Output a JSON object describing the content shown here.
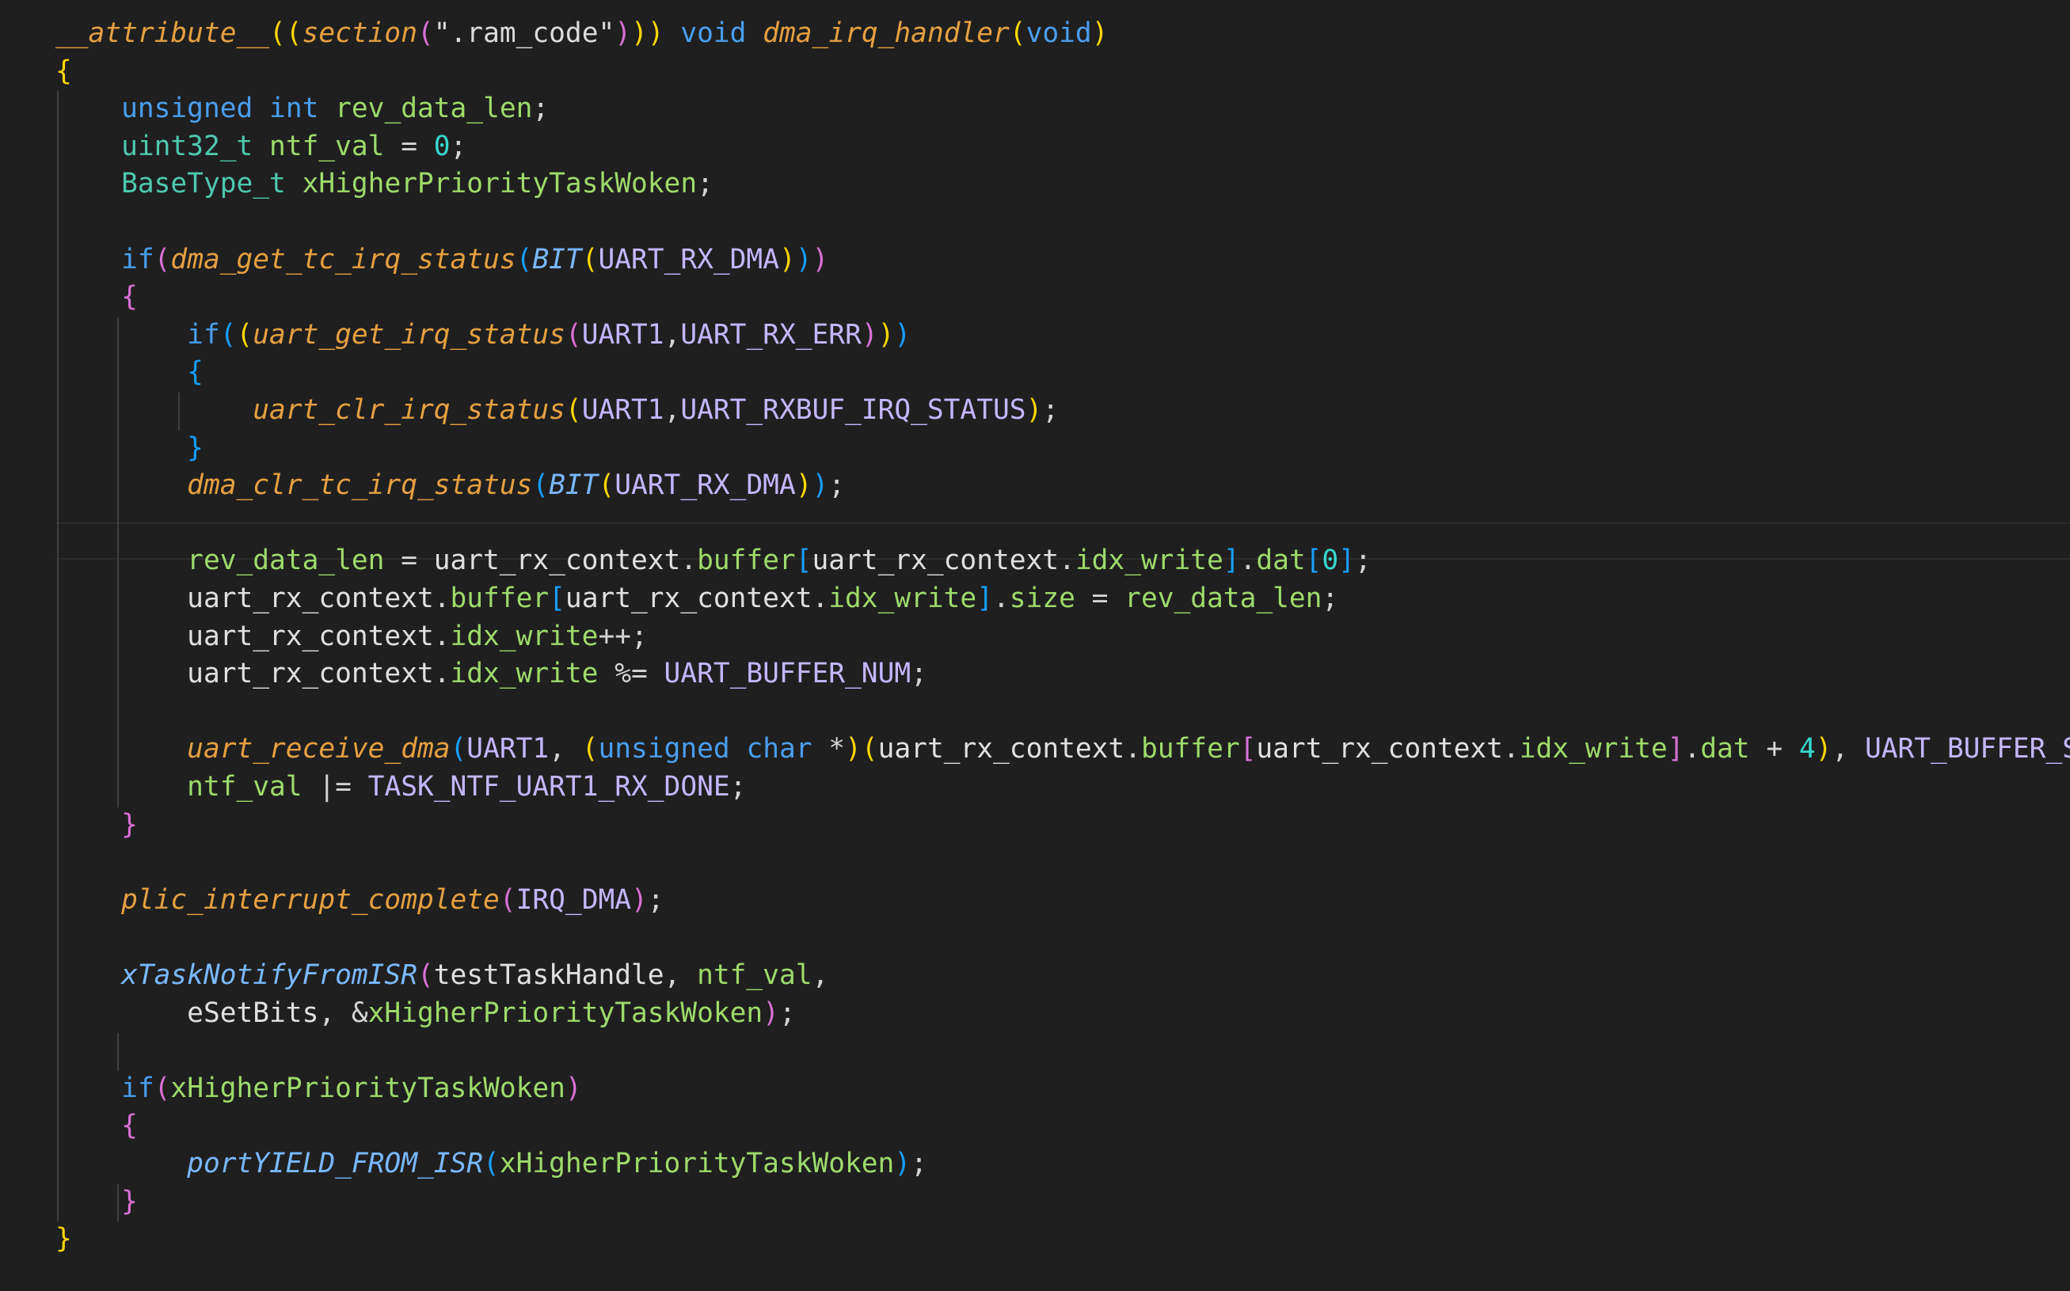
{
  "editor": {
    "theme": "dark",
    "colors": {
      "background": "#1f1f1f",
      "function": "#e5a040",
      "keyword": "#4a9eee",
      "type": "#4ec9b0",
      "variable": "#9ddb6b",
      "macro": "#c5b6ff",
      "number": "#37d8d0",
      "bracket_1": "#ffd700",
      "bracket_2": "#da70d6",
      "bracket_3": "#179fff"
    },
    "lines": [
      {
        "tokens": [
          {
            "t": "__attribute__",
            "c": "fn"
          },
          {
            "t": "((",
            "c": "p1"
          },
          {
            "t": "section",
            "c": "fn"
          },
          {
            "t": "(",
            "c": "p2"
          },
          {
            "t": "\".ram_code\"",
            "c": "str"
          },
          {
            "t": ")",
            "c": "p2"
          },
          {
            "t": "))",
            "c": "p1"
          },
          {
            "t": " ",
            "c": "plain"
          },
          {
            "t": "void",
            "c": "kw"
          },
          {
            "t": " ",
            "c": "plain"
          },
          {
            "t": "dma_irq_handler",
            "c": "fn"
          },
          {
            "t": "(",
            "c": "p1"
          },
          {
            "t": "void",
            "c": "kw"
          },
          {
            "t": ")",
            "c": "p1"
          }
        ]
      },
      {
        "tokens": [
          {
            "t": "{",
            "c": "p1"
          }
        ]
      },
      {
        "tokens": [
          {
            "t": "    ",
            "c": "plain"
          },
          {
            "t": "unsigned",
            "c": "kw"
          },
          {
            "t": " ",
            "c": "plain"
          },
          {
            "t": "int",
            "c": "kw"
          },
          {
            "t": " ",
            "c": "plain"
          },
          {
            "t": "rev_data_len",
            "c": "var"
          },
          {
            "t": ";",
            "c": "punc"
          }
        ]
      },
      {
        "tokens": [
          {
            "t": "    ",
            "c": "plain"
          },
          {
            "t": "uint32_t",
            "c": "type"
          },
          {
            "t": " ",
            "c": "plain"
          },
          {
            "t": "ntf_val",
            "c": "var"
          },
          {
            "t": " = ",
            "c": "op"
          },
          {
            "t": "0",
            "c": "num"
          },
          {
            "t": ";",
            "c": "punc"
          }
        ]
      },
      {
        "tokens": [
          {
            "t": "    ",
            "c": "plain"
          },
          {
            "t": "BaseType_t",
            "c": "type"
          },
          {
            "t": " ",
            "c": "plain"
          },
          {
            "t": "xHigherPriorityTaskWoken",
            "c": "var"
          },
          {
            "t": ";",
            "c": "punc"
          }
        ]
      },
      {
        "tokens": []
      },
      {
        "tokens": [
          {
            "t": "    ",
            "c": "plain"
          },
          {
            "t": "if",
            "c": "kw"
          },
          {
            "t": "(",
            "c": "p2"
          },
          {
            "t": "dma_get_tc_irq_status",
            "c": "fn"
          },
          {
            "t": "(",
            "c": "p3"
          },
          {
            "t": "BIT",
            "c": "mfn"
          },
          {
            "t": "(",
            "c": "p1"
          },
          {
            "t": "UART_RX_DMA",
            "c": "mac"
          },
          {
            "t": ")",
            "c": "p1"
          },
          {
            "t": ")",
            "c": "p3"
          },
          {
            "t": ")",
            "c": "p2"
          }
        ]
      },
      {
        "tokens": [
          {
            "t": "    ",
            "c": "plain"
          },
          {
            "t": "{",
            "c": "p2"
          }
        ]
      },
      {
        "tokens": [
          {
            "t": "        ",
            "c": "plain"
          },
          {
            "t": "if",
            "c": "kw"
          },
          {
            "t": "(",
            "c": "p3"
          },
          {
            "t": "(",
            "c": "p1"
          },
          {
            "t": "uart_get_irq_status",
            "c": "fn"
          },
          {
            "t": "(",
            "c": "p2"
          },
          {
            "t": "UART1",
            "c": "mac"
          },
          {
            "t": ",",
            "c": "punc"
          },
          {
            "t": "UART_RX_ERR",
            "c": "mac"
          },
          {
            "t": ")",
            "c": "p2"
          },
          {
            "t": ")",
            "c": "p1"
          },
          {
            "t": ")",
            "c": "p3"
          }
        ]
      },
      {
        "tokens": [
          {
            "t": "        ",
            "c": "plain"
          },
          {
            "t": "{",
            "c": "p3"
          }
        ]
      },
      {
        "tokens": [
          {
            "t": "            ",
            "c": "plain"
          },
          {
            "t": "uart_clr_irq_status",
            "c": "fn"
          },
          {
            "t": "(",
            "c": "p1"
          },
          {
            "t": "UART1",
            "c": "mac"
          },
          {
            "t": ",",
            "c": "punc"
          },
          {
            "t": "UART_RXBUF_IRQ_STATUS",
            "c": "mac"
          },
          {
            "t": ")",
            "c": "p1"
          },
          {
            "t": ";",
            "c": "punc"
          }
        ]
      },
      {
        "tokens": [
          {
            "t": "        ",
            "c": "plain"
          },
          {
            "t": "}",
            "c": "p3"
          }
        ]
      },
      {
        "tokens": [
          {
            "t": "        ",
            "c": "plain"
          },
          {
            "t": "dma_clr_tc_irq_status",
            "c": "fn"
          },
          {
            "t": "(",
            "c": "p3"
          },
          {
            "t": "BIT",
            "c": "mfn"
          },
          {
            "t": "(",
            "c": "p1"
          },
          {
            "t": "UART_RX_DMA",
            "c": "mac"
          },
          {
            "t": ")",
            "c": "p1"
          },
          {
            "t": ")",
            "c": "p3"
          },
          {
            "t": ";",
            "c": "punc"
          }
        ]
      },
      {
        "tokens": []
      },
      {
        "tokens": [
          {
            "t": "        ",
            "c": "plain"
          },
          {
            "t": "rev_data_len",
            "c": "var"
          },
          {
            "t": " = ",
            "c": "op"
          },
          {
            "t": "uart_rx_context",
            "c": "plain"
          },
          {
            "t": ".",
            "c": "punc"
          },
          {
            "t": "buffer",
            "c": "var"
          },
          {
            "t": "[",
            "c": "p3"
          },
          {
            "t": "uart_rx_context",
            "c": "plain"
          },
          {
            "t": ".",
            "c": "punc"
          },
          {
            "t": "idx_write",
            "c": "var"
          },
          {
            "t": "]",
            "c": "p3"
          },
          {
            "t": ".",
            "c": "punc"
          },
          {
            "t": "dat",
            "c": "var"
          },
          {
            "t": "[",
            "c": "p3"
          },
          {
            "t": "0",
            "c": "num"
          },
          {
            "t": "]",
            "c": "p3"
          },
          {
            "t": ";",
            "c": "punc"
          }
        ]
      },
      {
        "tokens": [
          {
            "t": "        ",
            "c": "plain"
          },
          {
            "t": "uart_rx_context",
            "c": "plain"
          },
          {
            "t": ".",
            "c": "punc"
          },
          {
            "t": "buffer",
            "c": "var"
          },
          {
            "t": "[",
            "c": "p3"
          },
          {
            "t": "uart_rx_context",
            "c": "plain"
          },
          {
            "t": ".",
            "c": "punc"
          },
          {
            "t": "idx_write",
            "c": "var"
          },
          {
            "t": "]",
            "c": "p3"
          },
          {
            "t": ".",
            "c": "punc"
          },
          {
            "t": "size",
            "c": "var"
          },
          {
            "t": " = ",
            "c": "op"
          },
          {
            "t": "rev_data_len",
            "c": "var"
          },
          {
            "t": ";",
            "c": "punc"
          }
        ]
      },
      {
        "tokens": [
          {
            "t": "        ",
            "c": "plain"
          },
          {
            "t": "uart_rx_context",
            "c": "plain"
          },
          {
            "t": ".",
            "c": "punc"
          },
          {
            "t": "idx_write",
            "c": "var"
          },
          {
            "t": "++",
            "c": "op"
          },
          {
            "t": ";",
            "c": "punc"
          }
        ]
      },
      {
        "tokens": [
          {
            "t": "        ",
            "c": "plain"
          },
          {
            "t": "uart_rx_context",
            "c": "plain"
          },
          {
            "t": ".",
            "c": "punc"
          },
          {
            "t": "idx_write",
            "c": "var"
          },
          {
            "t": " %= ",
            "c": "op"
          },
          {
            "t": "UART_BUFFER_NUM",
            "c": "mac"
          },
          {
            "t": ";",
            "c": "punc"
          }
        ]
      },
      {
        "tokens": []
      },
      {
        "tokens": [
          {
            "t": "        ",
            "c": "plain"
          },
          {
            "t": "uart_receive_dma",
            "c": "fn"
          },
          {
            "t": "(",
            "c": "p3"
          },
          {
            "t": "UART1",
            "c": "mac"
          },
          {
            "t": ", ",
            "c": "punc"
          },
          {
            "t": "(",
            "c": "p1"
          },
          {
            "t": "unsigned",
            "c": "kw"
          },
          {
            "t": " ",
            "c": "plain"
          },
          {
            "t": "char",
            "c": "kw"
          },
          {
            "t": " *",
            "c": "op"
          },
          {
            "t": ")",
            "c": "p1"
          },
          {
            "t": "(",
            "c": "p1"
          },
          {
            "t": "uart_rx_context",
            "c": "plain"
          },
          {
            "t": ".",
            "c": "punc"
          },
          {
            "t": "buffer",
            "c": "var"
          },
          {
            "t": "[",
            "c": "p2"
          },
          {
            "t": "uart_rx_context",
            "c": "plain"
          },
          {
            "t": ".",
            "c": "punc"
          },
          {
            "t": "idx_write",
            "c": "var"
          },
          {
            "t": "]",
            "c": "p2"
          },
          {
            "t": ".",
            "c": "punc"
          },
          {
            "t": "dat",
            "c": "var"
          },
          {
            "t": " + ",
            "c": "op"
          },
          {
            "t": "4",
            "c": "num"
          },
          {
            "t": ")",
            "c": "p1"
          },
          {
            "t": ", ",
            "c": "punc"
          },
          {
            "t": "UART_BUFFER_SIZE",
            "c": "mac"
          },
          {
            "t": ")",
            "c": "p3"
          },
          {
            "t": ";",
            "c": "punc"
          }
        ]
      },
      {
        "tokens": [
          {
            "t": "        ",
            "c": "plain"
          },
          {
            "t": "ntf_val",
            "c": "var"
          },
          {
            "t": " |= ",
            "c": "op"
          },
          {
            "t": "TASK_NTF_UART1_RX_DONE",
            "c": "mac"
          },
          {
            "t": ";",
            "c": "punc"
          }
        ]
      },
      {
        "tokens": [
          {
            "t": "    ",
            "c": "plain"
          },
          {
            "t": "}",
            "c": "p2"
          }
        ]
      },
      {
        "tokens": []
      },
      {
        "tokens": [
          {
            "t": "    ",
            "c": "plain"
          },
          {
            "t": "plic_interrupt_complete",
            "c": "fn"
          },
          {
            "t": "(",
            "c": "p2"
          },
          {
            "t": "IRQ_DMA",
            "c": "mac"
          },
          {
            "t": ")",
            "c": "p2"
          },
          {
            "t": ";",
            "c": "punc"
          }
        ]
      },
      {
        "tokens": []
      },
      {
        "tokens": [
          {
            "t": "    ",
            "c": "plain"
          },
          {
            "t": "xTaskNotifyFromISR",
            "c": "mfn"
          },
          {
            "t": "(",
            "c": "p2"
          },
          {
            "t": "testTaskHandle",
            "c": "plain"
          },
          {
            "t": ", ",
            "c": "punc"
          },
          {
            "t": "ntf_val",
            "c": "var"
          },
          {
            "t": ",",
            "c": "punc"
          }
        ]
      },
      {
        "tokens": [
          {
            "t": "        ",
            "c": "plain"
          },
          {
            "t": "eSetBits",
            "c": "plain"
          },
          {
            "t": ", &",
            "c": "op"
          },
          {
            "t": "xHigherPriorityTaskWoken",
            "c": "var"
          },
          {
            "t": ")",
            "c": "p2"
          },
          {
            "t": ";",
            "c": "punc"
          }
        ]
      },
      {
        "tokens": []
      },
      {
        "tokens": [
          {
            "t": "    ",
            "c": "plain"
          },
          {
            "t": "if",
            "c": "kw"
          },
          {
            "t": "(",
            "c": "p2"
          },
          {
            "t": "xHigherPriorityTaskWoken",
            "c": "var"
          },
          {
            "t": ")",
            "c": "p2"
          }
        ]
      },
      {
        "tokens": [
          {
            "t": "    ",
            "c": "plain"
          },
          {
            "t": "{",
            "c": "p2"
          }
        ]
      },
      {
        "tokens": [
          {
            "t": "        ",
            "c": "plain"
          },
          {
            "t": "portYIELD_FROM_ISR",
            "c": "mfn"
          },
          {
            "t": "(",
            "c": "p3"
          },
          {
            "t": "xHigherPriorityTaskWoken",
            "c": "var"
          },
          {
            "t": ")",
            "c": "p3"
          },
          {
            "t": ";",
            "c": "punc"
          }
        ]
      },
      {
        "tokens": [
          {
            "t": "    ",
            "c": "plain"
          },
          {
            "t": "}",
            "c": "p2"
          }
        ]
      },
      {
        "tokens": [
          {
            "t": "}",
            "c": "p1"
          }
        ]
      }
    ]
  }
}
